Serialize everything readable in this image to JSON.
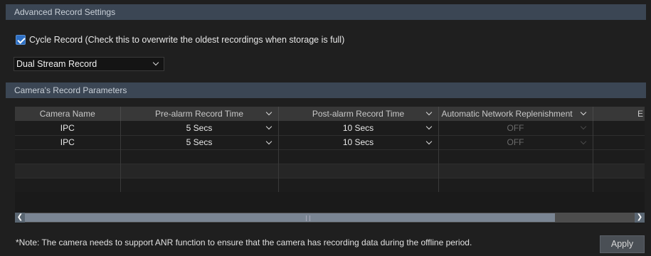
{
  "advanced": {
    "header": "Advanced Record Settings",
    "cycle_checked": true,
    "cycle_label": "Cycle Record (Check this to overwrite the oldest recordings when storage is full)",
    "stream_select": "Dual Stream Record"
  },
  "params": {
    "header": "Camera's Record Parameters",
    "columns": [
      "Camera Name",
      "Pre-alarm Record Time",
      "Post-alarm Record Time",
      "Automatic Network Replenishment",
      "E"
    ],
    "rows": [
      {
        "camera": "IPC",
        "pre": "5 Secs",
        "post": "10 Secs",
        "anr": "OFF"
      },
      {
        "camera": "IPC",
        "pre": "5 Secs",
        "post": "10 Secs",
        "anr": "OFF"
      }
    ]
  },
  "footer": {
    "note": "*Note: The camera needs to support ANR function to ensure that the camera has recording data during the offline period.",
    "apply_label": "Apply"
  }
}
